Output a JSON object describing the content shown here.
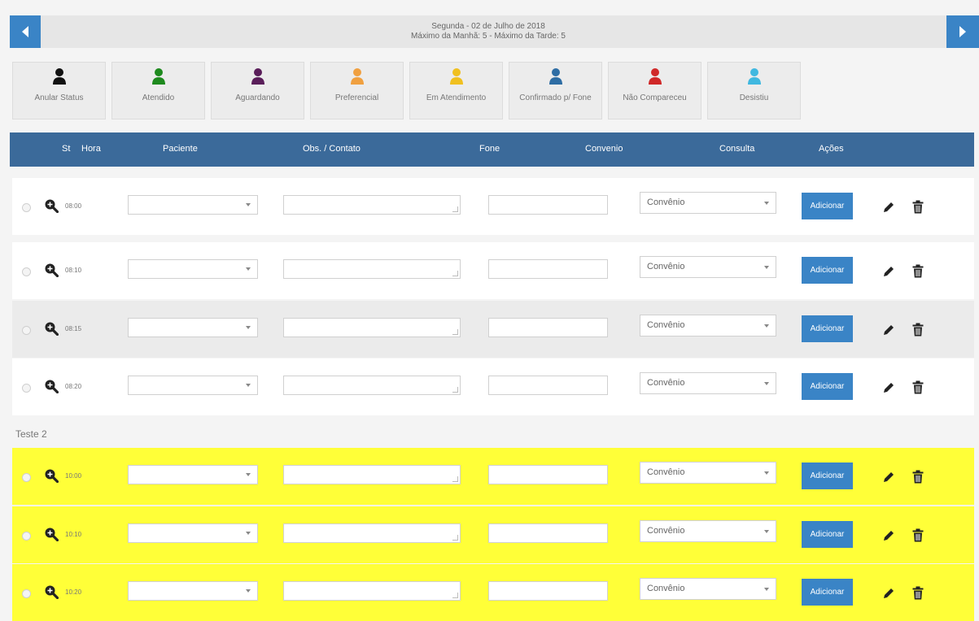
{
  "header": {
    "date_line": "Segunda - 02 de Julho de 2018",
    "max_line": "Máximo da Manhã: 5 - Máximo da Tarde: 5"
  },
  "status_buttons": [
    {
      "label": "Anular Status",
      "color": "#111111"
    },
    {
      "label": "Atendido",
      "color": "#1e8a1e"
    },
    {
      "label": "Aguardando",
      "color": "#5a1e5a"
    },
    {
      "label": "Preferencial",
      "color": "#f0a040"
    },
    {
      "label": "Em Atendimento",
      "color": "#f0c020"
    },
    {
      "label": "Confirmado p/ Fone",
      "color": "#2e6da4"
    },
    {
      "label": "Não Compareceu",
      "color": "#d02828"
    },
    {
      "label": "Desistiu",
      "color": "#40b8e0"
    }
  ],
  "table_header": {
    "st": "St",
    "hora": "Hora",
    "paciente": "Paciente",
    "obs": "Obs. / Contato",
    "fone": "Fone",
    "convenio": "Convenio",
    "consulta": "Consulta",
    "acoes": "Ações"
  },
  "section_label": "Teste 2",
  "convenio_placeholder": "Convênio",
  "add_label": "Adicionar",
  "rows": [
    {
      "time": "08:00",
      "style": "white"
    },
    {
      "time": "08:10",
      "style": "white"
    },
    {
      "time": "08:15",
      "style": "grey"
    },
    {
      "time": "08:20",
      "style": "white"
    },
    {
      "time": "10:00",
      "style": "yellow"
    },
    {
      "time": "10:10",
      "style": "yellow"
    },
    {
      "time": "10:20",
      "style": "yellow"
    }
  ],
  "colors": {
    "accent": "#3a84c6",
    "header_bar": "#3b6a9a",
    "highlight": "#ffff38"
  },
  "icons": [
    "chevron-left-icon",
    "chevron-right-icon",
    "person-icon",
    "search-plus-icon",
    "pencil-icon",
    "trash-icon"
  ]
}
